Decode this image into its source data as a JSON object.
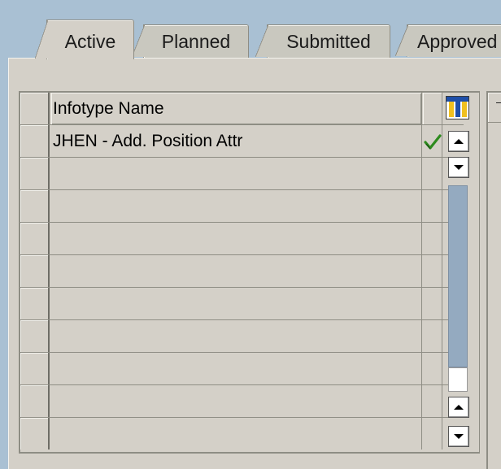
{
  "tabs": [
    {
      "label": "Active",
      "selected": true
    },
    {
      "label": "Planned",
      "selected": false
    },
    {
      "label": "Submitted",
      "selected": false
    },
    {
      "label": "Approved",
      "selected": false
    }
  ],
  "table": {
    "column_header": "Infotype Name",
    "column_settings_icon": "column-layout-icon",
    "rows": [
      {
        "name": "JHEN - Add. Position Attr",
        "status_icon": "green-checkmark-icon"
      },
      {
        "name": ""
      },
      {
        "name": ""
      },
      {
        "name": ""
      },
      {
        "name": ""
      },
      {
        "name": ""
      },
      {
        "name": ""
      },
      {
        "name": ""
      },
      {
        "name": ""
      },
      {
        "name": ""
      }
    ]
  },
  "colors": {
    "background": "#a9c0d3",
    "panel": "#d4d0c8",
    "check": "#2e8b1e",
    "scroll_track": "#94aac0"
  }
}
